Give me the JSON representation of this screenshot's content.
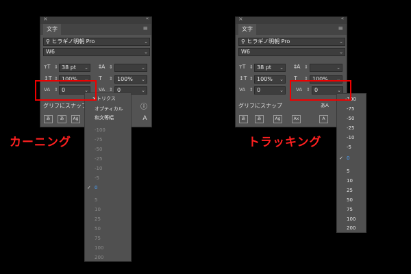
{
  "panel": {
    "tab_label": "文字",
    "close_glyph": "×",
    "collapse_glyph": "«",
    "menu_glyph": "≡",
    "font_family_left": "ヒラギノ明朝 Pro",
    "font_family_right": "ヒラギノ明朝 Pro",
    "font_style": "W6",
    "font_size": "38 pt",
    "vertical_scale": "100%",
    "horizontal_scale": "100%",
    "kerning_value": "0",
    "tracking_value": "0",
    "glyph_snap_label": "グリフにスナップ",
    "info_glyph": "ⓘ"
  },
  "icons": {
    "search": "search-icon",
    "font_size": "font-size-icon",
    "leading": "leading-icon",
    "vertical_scale": "vertical-scale-icon",
    "horizontal_scale": "horizontal-scale-icon",
    "kerning": "kerning-icon",
    "tracking": "tracking-icon"
  },
  "kerning_dropdown": {
    "methods": [
      "メトリクス",
      "オプティカル",
      "和文等幅"
    ],
    "values": [
      "-100",
      "-75",
      "-50",
      "-25",
      "-10",
      "-5",
      "0",
      "5",
      "10",
      "25",
      "50",
      "75",
      "100",
      "200"
    ],
    "selected": "0"
  },
  "tracking_dropdown": {
    "values": [
      "-100",
      "-75",
      "-50",
      "-25",
      "-10",
      "-5",
      "0",
      "5",
      "10",
      "25",
      "50",
      "75",
      "100",
      "200"
    ],
    "selected": "0"
  },
  "captions": {
    "kerning": "カーニング",
    "tracking": "トラッキング"
  },
  "colors": {
    "highlight": "#ee0000",
    "caption": "#ff2020",
    "selected_value": "#4aa3ff"
  }
}
